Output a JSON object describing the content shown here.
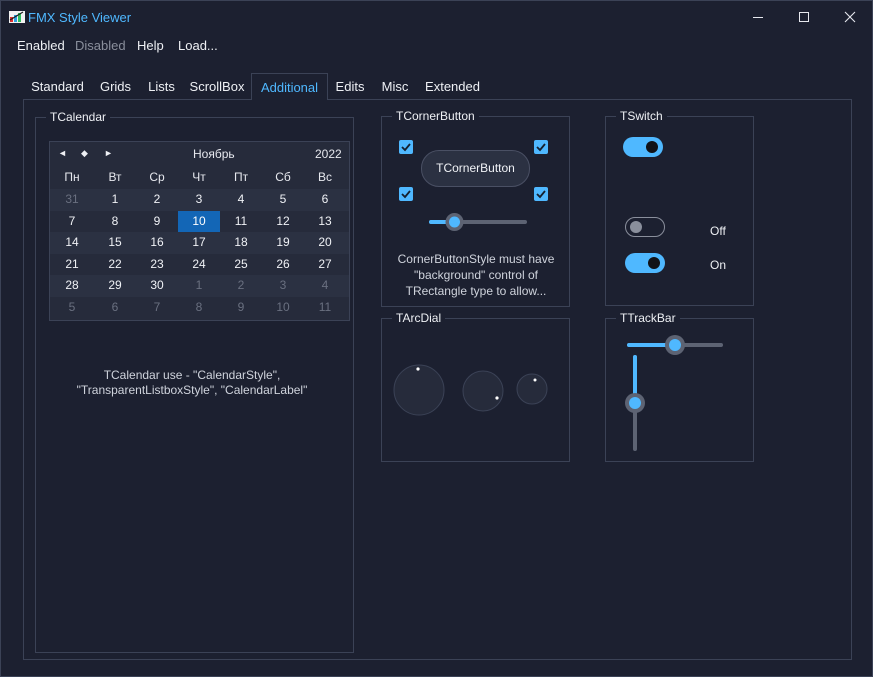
{
  "window": {
    "title": "FMX Style Viewer",
    "min_glyph": "—",
    "max_glyph": "☐",
    "close_glyph": "✕"
  },
  "menu": [
    {
      "label": "Enabled",
      "enabled": true
    },
    {
      "label": "Disabled",
      "enabled": false
    },
    {
      "label": "Help",
      "enabled": true
    },
    {
      "label": "Load...",
      "enabled": true
    }
  ],
  "tabs": [
    {
      "label": "Standard",
      "active": false
    },
    {
      "label": "Grids",
      "active": false
    },
    {
      "label": "Lists",
      "active": false
    },
    {
      "label": "ScrollBox",
      "active": false
    },
    {
      "label": "Additional",
      "active": true
    },
    {
      "label": "Edits",
      "active": false
    },
    {
      "label": "Misc",
      "active": false
    },
    {
      "label": "Extended",
      "active": false
    }
  ],
  "calendar_group": {
    "title": "TCalendar",
    "caption_line1": "TCalendar use - \"CalendarStyle\",",
    "caption_line2": "\"TransparentListboxStyle\", \"CalendarLabel\""
  },
  "calendar": {
    "prev_glyph": "◄",
    "today_glyph": "◆",
    "next_glyph": "►",
    "month": "Ноябрь",
    "year": "2022",
    "weekdays": [
      "Пн",
      "Вт",
      "Ср",
      "Чт",
      "Пт",
      "Сб",
      "Вс"
    ],
    "weeks": [
      [
        {
          "d": "31",
          "o": true
        },
        {
          "d": "1"
        },
        {
          "d": "2"
        },
        {
          "d": "3"
        },
        {
          "d": "4"
        },
        {
          "d": "5"
        },
        {
          "d": "6"
        }
      ],
      [
        {
          "d": "7"
        },
        {
          "d": "8"
        },
        {
          "d": "9"
        },
        {
          "d": "10",
          "s": true
        },
        {
          "d": "11"
        },
        {
          "d": "12"
        },
        {
          "d": "13"
        }
      ],
      [
        {
          "d": "14"
        },
        {
          "d": "15"
        },
        {
          "d": "16"
        },
        {
          "d": "17"
        },
        {
          "d": "18"
        },
        {
          "d": "19"
        },
        {
          "d": "20"
        }
      ],
      [
        {
          "d": "21"
        },
        {
          "d": "22"
        },
        {
          "d": "23"
        },
        {
          "d": "24"
        },
        {
          "d": "25"
        },
        {
          "d": "26"
        },
        {
          "d": "27"
        }
      ],
      [
        {
          "d": "28"
        },
        {
          "d": "29"
        },
        {
          "d": "30"
        },
        {
          "d": "1",
          "o": true
        },
        {
          "d": "2",
          "o": true
        },
        {
          "d": "3",
          "o": true
        },
        {
          "d": "4",
          "o": true
        }
      ],
      [
        {
          "d": "5",
          "o": true
        },
        {
          "d": "6",
          "o": true
        },
        {
          "d": "7",
          "o": true
        },
        {
          "d": "8",
          "o": true
        },
        {
          "d": "9",
          "o": true
        },
        {
          "d": "10",
          "o": true
        },
        {
          "d": "11",
          "o": true
        }
      ]
    ]
  },
  "corner_group": {
    "title": "TCornerButton",
    "button_label": "TCornerButton",
    "note_line1": "CornerButtonStyle must have",
    "note_line2": "\"background\" control of",
    "note_line3": "TRectangle type to allow...",
    "trackbar_value": 0.25
  },
  "switch_group": {
    "title": "TSwitch",
    "switch1_on": true,
    "switch2_on": false,
    "switch2_label": "Off",
    "switch3_on": true,
    "switch3_label": "On"
  },
  "arcdial_group": {
    "title": "TArcDial"
  },
  "trackbar_group": {
    "title": "TTrackBar",
    "horizontal_value": 0.5,
    "vertical_value": 0.5
  },
  "colors": {
    "accent": "#4fb8ff",
    "background": "#1c2030",
    "border": "#3b4256",
    "selected_day": "#1366b6"
  }
}
